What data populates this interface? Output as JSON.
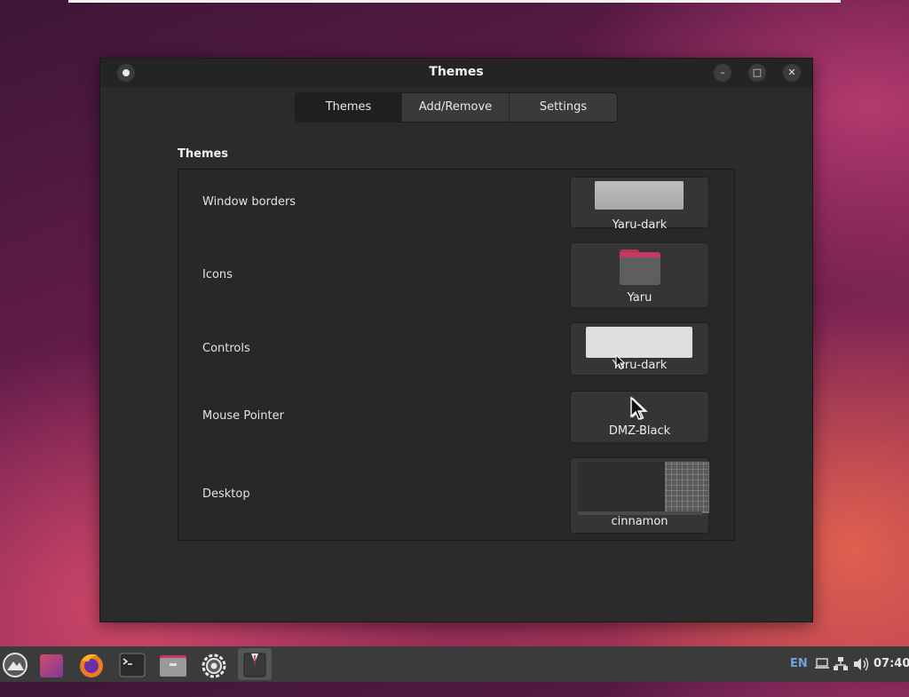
{
  "window": {
    "title": "Themes",
    "tabs": [
      {
        "label": "Themes",
        "active": true
      },
      {
        "label": "Add/Remove",
        "active": false
      },
      {
        "label": "Settings",
        "active": false
      }
    ],
    "section_title": "Themes",
    "rows": [
      {
        "label": "Window borders",
        "value": "Yaru-dark"
      },
      {
        "label": "Icons",
        "value": "Yaru"
      },
      {
        "label": "Controls",
        "value": "Yaru-dark"
      },
      {
        "label": "Mouse Pointer",
        "value": "DMZ-Black"
      },
      {
        "label": "Desktop",
        "value": "cinnamon"
      }
    ]
  },
  "taskbar": {
    "icons": [
      "menu-icon",
      "app-store-icon",
      "firefox-icon",
      "terminal-icon",
      "file-manager-icon",
      "settings-icon",
      "themes-app-icon"
    ],
    "keyboard_layout": "EN",
    "clock": "07:40"
  },
  "colors": {
    "accent": "#c23a60",
    "window_bg": "#2b2b2b",
    "taskbar_bg": "#3b3b3b"
  }
}
